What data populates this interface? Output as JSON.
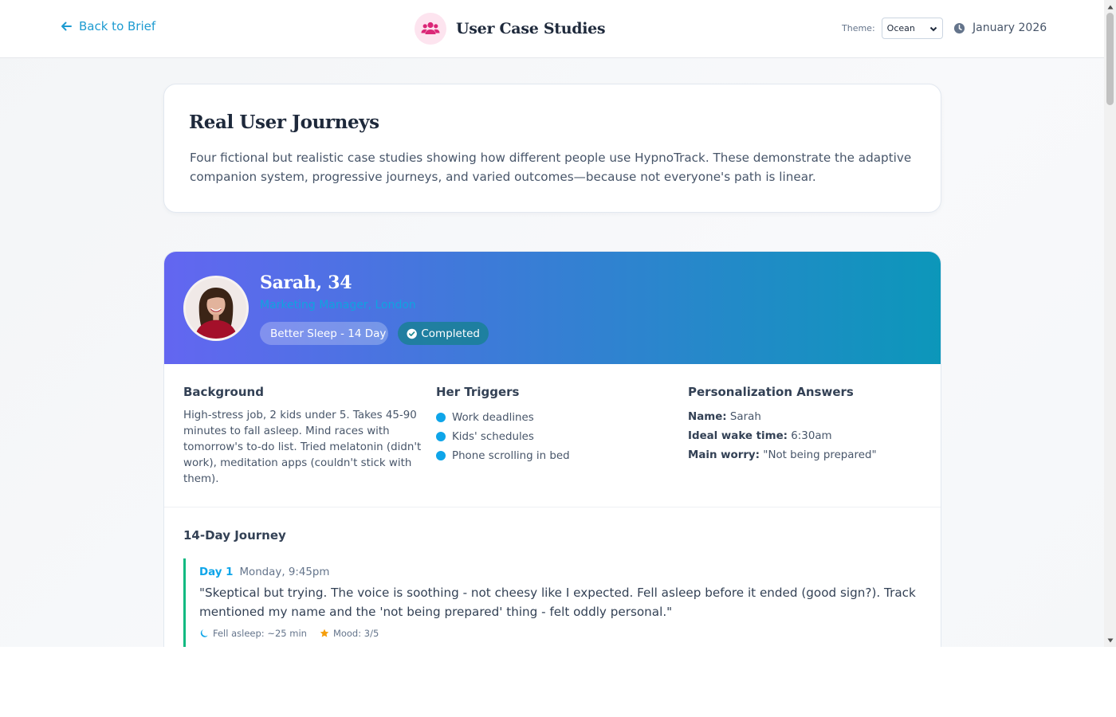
{
  "header": {
    "back_label": "Back to Brief",
    "title": "User Case Studies",
    "theme_label": "Theme:",
    "theme_value": "Ocean",
    "date": "January 2026",
    "brand_color": "#db2777"
  },
  "intro": {
    "title": "Real User Journeys",
    "text": "Four fictional but realistic case studies showing how different people use HypnoTrack. These demonstrate the adaptive companion system, progressive journeys, and varied outcomes—because not everyone's path is linear."
  },
  "case": {
    "name": "Sarah, 34",
    "role": "Marketing Manager, London",
    "program": "Better Sleep - 14 Day",
    "status": "Completed",
    "background": {
      "heading": "Background",
      "text": "High-stress job, 2 kids under 5. Takes 45-90 minutes to fall asleep. Mind races with tomorrow's to-do list. Tried melatonin (didn't work), meditation apps (couldn't stick with them)."
    },
    "triggers": {
      "heading": "Her Triggers",
      "items": [
        "Work deadlines",
        "Kids' schedules",
        "Phone scrolling in bed"
      ]
    },
    "personalization": {
      "heading": "Personalization Answers",
      "rows": [
        {
          "key": "Name:",
          "value": "Sarah"
        },
        {
          "key": "Ideal wake time:",
          "value": "6:30am"
        },
        {
          "key": "Main worry:",
          "value": "\"Not being prepared\""
        }
      ]
    },
    "journey": {
      "heading": "14-Day Journey",
      "entries": [
        {
          "day": "Day 1",
          "time": "Monday, 9:45pm",
          "quote": "\"Skeptical but trying. The voice is soothing - not cheesy like I expected. Fell asleep before it ended (good sign?). Track mentioned my name and the 'not being prepared' thing - felt oddly personal.\"",
          "sleep": "Fell asleep: ~25 min",
          "mood": "Mood: 3/5"
        }
      ]
    }
  },
  "colors": {
    "accent": "#0ea5e9",
    "link": "#1d9bd1",
    "journey_line": "#10b981",
    "gradient_start": "#6366f1",
    "gradient_end": "#0c97ba",
    "star": "#f59e0b"
  }
}
